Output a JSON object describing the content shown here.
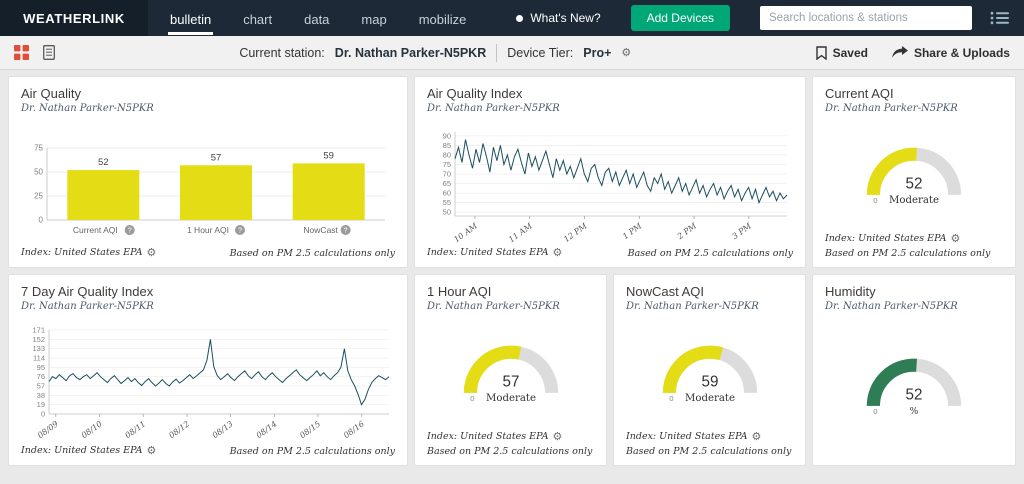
{
  "navbar": {
    "brand": "WEATHERLINK",
    "links": [
      {
        "label": "bulletin",
        "active": true
      },
      {
        "label": "chart",
        "active": false
      },
      {
        "label": "data",
        "active": false
      },
      {
        "label": "map",
        "active": false
      },
      {
        "label": "mobilize",
        "active": false
      }
    ],
    "whats_new": "What's New?",
    "add_devices_label": "Add Devices",
    "search_placeholder": "Search locations & stations"
  },
  "toolbar": {
    "current_station_label": "Current station:",
    "station_name": "Dr. Nathan Parker-N5PKR",
    "device_tier_label": "Device Tier:",
    "device_tier_value": "Pro+",
    "saved_label": "Saved",
    "share_label": "Share & Uploads"
  },
  "station_subtitle": "Dr. Nathan Parker-N5PKR",
  "footers": {
    "index_label": "Index: United States EPA",
    "pm_note": "Based on PM 2.5 calculations only"
  },
  "cards": {
    "air_quality": {
      "title": "Air Quality"
    },
    "aqi_index": {
      "title": "Air Quality Index"
    },
    "current_aqi": {
      "title": "Current AQI"
    },
    "seven_day": {
      "title": "7 Day Air Quality Index"
    },
    "one_hour": {
      "title": "1 Hour AQI"
    },
    "nowcast": {
      "title": "NowCast AQI"
    },
    "humidity": {
      "title": "Humidity"
    }
  },
  "colors": {
    "bar_yellow": "#e4dd15",
    "gauge_yellow": "#e4dd15",
    "humidity_green": "#2e7d55",
    "line_teal": "#1b4f5e",
    "accent_orange": "#e04e39",
    "button_green": "#00a878"
  },
  "chart_data": [
    {
      "id": "air_quality_bars",
      "type": "bar",
      "title": "Air Quality",
      "categories": [
        "Current AQI",
        "1 Hour AQI",
        "NowCast"
      ],
      "values": [
        52,
        57,
        59
      ],
      "ylim": [
        0,
        75
      ],
      "yticks": [
        0,
        25,
        50,
        75
      ],
      "color": "#e4dd15"
    },
    {
      "id": "aqi_intraday",
      "type": "line",
      "title": "Air Quality Index",
      "x_ticks": [
        "10 AM",
        "11 AM",
        "12 PM",
        "1 PM",
        "2 PM",
        "3 PM"
      ],
      "x_tick_pos": [
        0.06,
        0.225,
        0.39,
        0.555,
        0.72,
        0.885
      ],
      "yticks": [
        50,
        55,
        60,
        65,
        70,
        75,
        80,
        85,
        90
      ],
      "ylim": [
        48,
        92
      ],
      "color": "#1b4f5e",
      "values": [
        78,
        84,
        76,
        88,
        80,
        73,
        83,
        76,
        86,
        79,
        71,
        84,
        77,
        85,
        75,
        80,
        72,
        79,
        83,
        76,
        70,
        81,
        74,
        79,
        72,
        77,
        82,
        75,
        68,
        78,
        72,
        77,
        70,
        74,
        68,
        73,
        78,
        70,
        66,
        73,
        75,
        68,
        64,
        71,
        73,
        66,
        71,
        64,
        68,
        72,
        65,
        70,
        63,
        67,
        71,
        64,
        61,
        68,
        65,
        70,
        62,
        66,
        60,
        64,
        68,
        61,
        65,
        59,
        63,
        67,
        60,
        64,
        58,
        62,
        65,
        59,
        63,
        57,
        61,
        64,
        58,
        62,
        56,
        60,
        63,
        57,
        62,
        55,
        59,
        63,
        58,
        61,
        56,
        60,
        57,
        59
      ]
    },
    {
      "id": "aqi_7day",
      "type": "line",
      "title": "7 Day Air Quality Index",
      "x_ticks": [
        "08/09",
        "08/10",
        "08/11",
        "08/12",
        "08/13",
        "08/14",
        "08/15",
        "08/16"
      ],
      "x_tick_pos": [
        0.02,
        0.149,
        0.277,
        0.406,
        0.534,
        0.663,
        0.791,
        0.92
      ],
      "yticks": [
        0,
        19,
        38,
        57,
        76,
        95,
        114,
        133,
        152,
        171
      ],
      "ylim": [
        0,
        171
      ],
      "color": "#1b4f5e",
      "values": [
        66,
        76,
        72,
        80,
        74,
        68,
        78,
        82,
        74,
        70,
        76,
        80,
        72,
        78,
        84,
        76,
        70,
        64,
        72,
        78,
        70,
        62,
        68,
        74,
        66,
        72,
        64,
        58,
        66,
        72,
        64,
        57,
        63,
        70,
        62,
        57,
        65,
        71,
        63,
        68,
        74,
        80,
        72,
        78,
        84,
        90,
        110,
        152,
        96,
        78,
        70,
        76,
        82,
        74,
        68,
        76,
        82,
        88,
        78,
        72,
        80,
        86,
        76,
        70,
        78,
        84,
        76,
        70,
        64,
        72,
        78,
        84,
        90,
        80,
        74,
        68,
        74,
        80,
        88,
        78,
        84,
        76,
        70,
        78,
        84,
        95,
        133,
        88,
        70,
        57,
        40,
        19,
        30,
        50,
        64,
        72,
        78,
        74,
        70,
        76
      ]
    },
    {
      "id": "gauge_current_aqi",
      "type": "gauge",
      "title": "Current AQI",
      "value": 52,
      "min": 0,
      "max": 100,
      "min_label": "0",
      "caption": "Moderate",
      "color": "#e4dd15"
    },
    {
      "id": "gauge_one_hour",
      "type": "gauge",
      "title": "1 Hour AQI",
      "value": 57,
      "min": 0,
      "max": 100,
      "min_label": "0",
      "caption": "Moderate",
      "color": "#e4dd15"
    },
    {
      "id": "gauge_nowcast",
      "type": "gauge",
      "title": "NowCast AQI",
      "value": 59,
      "min": 0,
      "max": 100,
      "min_label": "0",
      "caption": "Moderate",
      "color": "#e4dd15"
    },
    {
      "id": "gauge_humidity",
      "type": "gauge",
      "title": "Humidity",
      "value": 52,
      "min": 0,
      "max": 100,
      "min_label": "0",
      "caption": "%",
      "color": "#2e7d55"
    }
  ]
}
